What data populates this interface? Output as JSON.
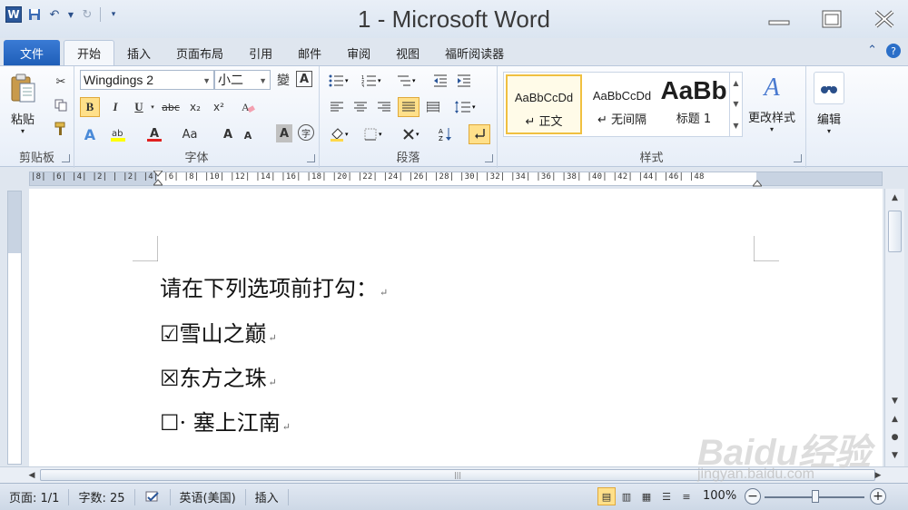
{
  "window": {
    "title": "1 - Microsoft Word",
    "app_logo": "W"
  },
  "tabs": [
    {
      "label": "文件"
    },
    {
      "label": "开始"
    },
    {
      "label": "插入"
    },
    {
      "label": "页面布局"
    },
    {
      "label": "引用"
    },
    {
      "label": "邮件"
    },
    {
      "label": "审阅"
    },
    {
      "label": "视图"
    },
    {
      "label": "福昕阅读器"
    }
  ],
  "ribbon": {
    "clipboard": {
      "label": "剪贴板",
      "paste_label": "粘贴"
    },
    "font": {
      "label": "字体",
      "font_name": "Wingdings 2",
      "font_size": "小二",
      "wen_glyph": "變",
      "a_box": "A",
      "bold": "B",
      "italic": "I",
      "underline": "U",
      "strike": "abc",
      "subscript": "x₂",
      "superscript": "x²",
      "grow": "A",
      "shrink": "A",
      "case": "Aa",
      "shade": "A",
      "enclose": "字"
    },
    "paragraph": {
      "label": "段落"
    },
    "styles": {
      "label": "样式",
      "items": [
        {
          "sample": "AaBbCcDd",
          "name": "↵ 正文"
        },
        {
          "sample": "AaBbCcDd",
          "name": "↵ 无间隔"
        },
        {
          "sample": "AaBb",
          "name": "标题 1"
        }
      ],
      "change_label": "更改样式"
    },
    "editing": {
      "label": "编辑"
    }
  },
  "ruler": {
    "numbers": "|8| |6| |4| |2| | |2| |4| |6| |8| |10| |12| |14| |16| |18| |20| |22| |24| |26| |28| |30| |32| |34| |36| |38| |40| |42| |44| |46| |48"
  },
  "document": {
    "lines": [
      {
        "text": "请在下列选项前打勾：",
        "mark": "↵"
      },
      {
        "box": "☑",
        "text": "雪山之巅",
        "mark": "↵"
      },
      {
        "box": "☒",
        "text": "东方之珠",
        "mark": "↵"
      },
      {
        "box": "☐",
        "text": "· 塞上江南",
        "mark": "↵"
      }
    ]
  },
  "status": {
    "page": "页面: 1/1",
    "words": "字数: 25",
    "language": "英语(美国)",
    "mode": "插入",
    "zoom": "100%",
    "zoom_value": 100
  },
  "watermark": {
    "line1": "Baidu经验",
    "line2": "jingyan.baidu.com"
  },
  "colors": {
    "accent": "#2b579a",
    "file_tab": "#1f5fb8",
    "selected": "#ffe08a"
  },
  "icons": [
    "word-logo-icon",
    "save-icon",
    "undo-icon",
    "redo-icon",
    "minimize-icon",
    "maximize-icon",
    "close-icon",
    "help-icon",
    "paste-icon",
    "cut-icon",
    "copy-icon",
    "format-painter-icon",
    "find-icon"
  ]
}
